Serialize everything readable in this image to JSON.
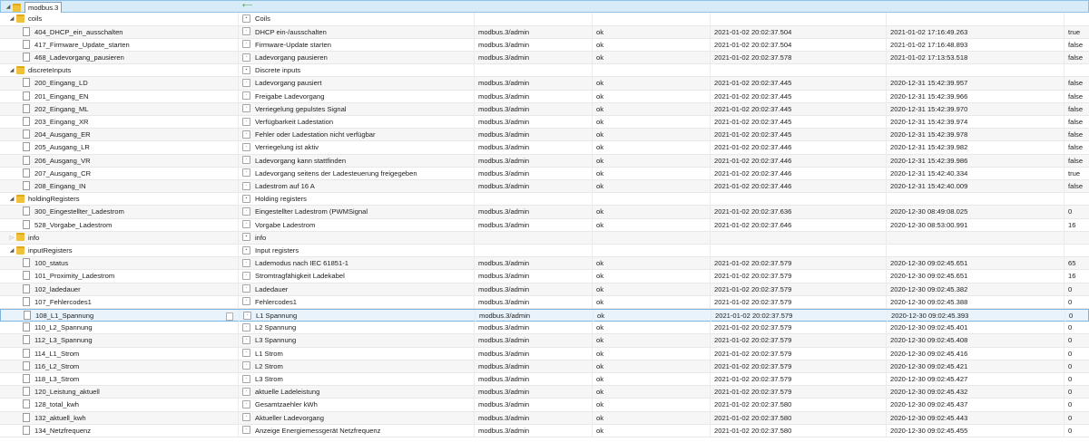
{
  "root": {
    "id": "modbus.3",
    "handle": "⟵"
  },
  "rows": [
    {
      "id": "coils",
      "kind": "folder",
      "level": 1,
      "expanded": true,
      "name": "Coils",
      "role": "",
      "val": "",
      "ts": "",
      "lc": "",
      "v": ""
    },
    {
      "id": "404_DHCP_ein_ausschalten",
      "kind": "state",
      "level": 2,
      "name": "DHCP ein-/ausschalten",
      "role": "modbus.3/admin",
      "val": "ok",
      "ts": "2021-01-02 20:02:37.504",
      "lc": "2021-01-02 17:16:49.263",
      "v": "true"
    },
    {
      "id": "417_Firmware_Update_starten",
      "kind": "state",
      "level": 2,
      "name": "Firmware-Update starten",
      "role": "modbus.3/admin",
      "val": "ok",
      "ts": "2021-01-02 20:02:37.504",
      "lc": "2021-01-02 17:16:48.893",
      "v": "false"
    },
    {
      "id": "468_Ladevorgang_pausieren",
      "kind": "state",
      "level": 2,
      "name": "Ladevorgang pausieren",
      "role": "modbus.3/admin",
      "val": "ok",
      "ts": "2021-01-02 20:02:37.578",
      "lc": "2021-01-02 17:13:53.518",
      "v": "false"
    },
    {
      "id": "discreteInputs",
      "kind": "folder",
      "level": 1,
      "expanded": true,
      "name": "Discrete inputs",
      "role": "",
      "val": "",
      "ts": "",
      "lc": "",
      "v": ""
    },
    {
      "id": "200_Eingang_LD",
      "kind": "state",
      "level": 2,
      "name": "Ladevorgang pausiert",
      "role": "modbus.3/admin",
      "val": "ok",
      "ts": "2021-01-02 20:02:37.445",
      "lc": "2020-12-31 15:42:39.957",
      "v": "false"
    },
    {
      "id": "201_Eingang_EN",
      "kind": "state",
      "level": 2,
      "name": "Freigabe Ladevorgang",
      "role": "modbus.3/admin",
      "val": "ok",
      "ts": "2021-01-02 20:02:37.445",
      "lc": "2020-12-31 15:42:39.966",
      "v": "false"
    },
    {
      "id": "202_Eingang_ML",
      "kind": "state",
      "level": 2,
      "name": "Verriegelung gepulstes Signal",
      "role": "modbus.3/admin",
      "val": "ok",
      "ts": "2021-01-02 20:02:37.445",
      "lc": "2020-12-31 15:42:39.970",
      "v": "false"
    },
    {
      "id": "203_Eingang_XR",
      "kind": "state",
      "level": 2,
      "name": "Verfügbarkeit Ladestation",
      "role": "modbus.3/admin",
      "val": "ok",
      "ts": "2021-01-02 20:02:37.445",
      "lc": "2020-12-31 15:42:39.974",
      "v": "false"
    },
    {
      "id": "204_Ausgang_ER",
      "kind": "state",
      "level": 2,
      "name": "Fehler oder Ladestation nicht verfügbar",
      "role": "modbus.3/admin",
      "val": "ok",
      "ts": "2021-01-02 20:02:37.445",
      "lc": "2020-12-31 15:42:39.978",
      "v": "false"
    },
    {
      "id": "205_Ausgang_LR",
      "kind": "state",
      "level": 2,
      "name": "Verriegelung ist aktiv",
      "role": "modbus.3/admin",
      "val": "ok",
      "ts": "2021-01-02 20:02:37.446",
      "lc": "2020-12-31 15:42:39.982",
      "v": "false"
    },
    {
      "id": "206_Ausgang_VR",
      "kind": "state",
      "level": 2,
      "name": "Ladevorgang kann stattfinden",
      "role": "modbus.3/admin",
      "val": "ok",
      "ts": "2021-01-02 20:02:37.446",
      "lc": "2020-12-31 15:42:39.986",
      "v": "false"
    },
    {
      "id": "207_Ausgang_CR",
      "kind": "state",
      "level": 2,
      "name": "Ladevorgang seitens der Ladesteuerung freigegeben",
      "role": "modbus.3/admin",
      "val": "ok",
      "ts": "2021-01-02 20:02:37.446",
      "lc": "2020-12-31 15:42:40.334",
      "v": "true"
    },
    {
      "id": "208_Eingang_IN",
      "kind": "state",
      "level": 2,
      "name": "Ladestrom auf 16 A",
      "role": "modbus.3/admin",
      "val": "ok",
      "ts": "2021-01-02 20:02:37.446",
      "lc": "2020-12-31 15:42:40.009",
      "v": "false"
    },
    {
      "id": "holdingRegisters",
      "kind": "folder",
      "level": 1,
      "expanded": true,
      "name": "Holding registers",
      "role": "",
      "val": "",
      "ts": "",
      "lc": "",
      "v": ""
    },
    {
      "id": "300_Eingestellter_Ladestrom",
      "kind": "state",
      "level": 2,
      "name": "Eingestellter Ladestrom (PWMSignal",
      "role": "modbus.3/admin",
      "val": "ok",
      "ts": "2021-01-02 20:02:37.636",
      "lc": "2020-12-30 08:49:08.025",
      "v": "0"
    },
    {
      "id": "528_Vorgabe_Ladestrom",
      "kind": "state",
      "level": 2,
      "name": "Vorgabe Ladestrom",
      "role": "modbus.3/admin",
      "val": "ok",
      "ts": "2021-01-02 20:02:37.646",
      "lc": "2020-12-30 08:53:00.991",
      "v": "16"
    },
    {
      "id": "info",
      "kind": "folder",
      "level": 1,
      "expanded": false,
      "name": "info",
      "role": "",
      "val": "",
      "ts": "",
      "lc": "",
      "v": ""
    },
    {
      "id": "inputRegisters",
      "kind": "folder",
      "level": 1,
      "expanded": true,
      "name": "Input registers",
      "role": "",
      "val": "",
      "ts": "",
      "lc": "",
      "v": ""
    },
    {
      "id": "100_status",
      "kind": "state",
      "level": 2,
      "name": "Lademodus nach IEC 61851-1",
      "role": "modbus.3/admin",
      "val": "ok",
      "ts": "2021-01-02 20:02:37.579",
      "lc": "2020-12-30 09:02:45.651",
      "v": "65"
    },
    {
      "id": "101_Proximity_Ladestrom",
      "kind": "state",
      "level": 2,
      "name": "Stromtragfähigkeit Ladekabel",
      "role": "modbus.3/admin",
      "val": "ok",
      "ts": "2021-01-02 20:02:37.579",
      "lc": "2020-12-30 09:02:45.651",
      "v": "16"
    },
    {
      "id": "102_ladedauer",
      "kind": "state",
      "level": 2,
      "name": "Ladedauer",
      "role": "modbus.3/admin",
      "val": "ok",
      "ts": "2021-01-02 20:02:37.579",
      "lc": "2020-12-30 09:02:45.382",
      "v": "0"
    },
    {
      "id": "107_Fehlercodes1",
      "kind": "state",
      "level": 2,
      "name": "Fehlercodes1",
      "role": "modbus.3/admin",
      "val": "ok",
      "ts": "2021-01-02 20:02:37.579",
      "lc": "2020-12-30 09:02:45.388",
      "v": "0"
    },
    {
      "id": "108_L1_Spannung",
      "kind": "state",
      "level": 2,
      "selected": true,
      "name": "L1 Spannung",
      "role": "modbus.3/admin",
      "val": "ok",
      "ts": "2021-01-02 20:02:37.579",
      "lc": "2020-12-30 09:02:45.393",
      "v": "0"
    },
    {
      "id": "110_L2_Spannung",
      "kind": "state",
      "level": 2,
      "name": "L2 Spannung",
      "role": "modbus.3/admin",
      "val": "ok",
      "ts": "2021-01-02 20:02:37.579",
      "lc": "2020-12-30 09:02:45.401",
      "v": "0"
    },
    {
      "id": "112_L3_Spannung",
      "kind": "state",
      "level": 2,
      "name": "L3 Spannung",
      "role": "modbus.3/admin",
      "val": "ok",
      "ts": "2021-01-02 20:02:37.579",
      "lc": "2020-12-30 09:02:45.408",
      "v": "0"
    },
    {
      "id": "114_L1_Strom",
      "kind": "state",
      "level": 2,
      "name": "L1 Strom",
      "role": "modbus.3/admin",
      "val": "ok",
      "ts": "2021-01-02 20:02:37.579",
      "lc": "2020-12-30 09:02:45.416",
      "v": "0"
    },
    {
      "id": "116_L2_Strom",
      "kind": "state",
      "level": 2,
      "name": "L2 Strom",
      "role": "modbus.3/admin",
      "val": "ok",
      "ts": "2021-01-02 20:02:37.579",
      "lc": "2020-12-30 09:02:45.421",
      "v": "0"
    },
    {
      "id": "118_L3_Strom",
      "kind": "state",
      "level": 2,
      "name": "L3 Strom",
      "role": "modbus.3/admin",
      "val": "ok",
      "ts": "2021-01-02 20:02:37.579",
      "lc": "2020-12-30 09:02:45.427",
      "v": "0"
    },
    {
      "id": "120_Leistung_aktuell",
      "kind": "state",
      "level": 2,
      "name": "aktuelle Ladeleistung",
      "role": "modbus.3/admin",
      "val": "ok",
      "ts": "2021-01-02 20:02:37.579",
      "lc": "2020-12-30 09:02:45.432",
      "v": "0"
    },
    {
      "id": "128_total_kwh",
      "kind": "state",
      "level": 2,
      "name": "Gesamtzaehler kWh",
      "role": "modbus.3/admin",
      "val": "ok",
      "ts": "2021-01-02 20:02:37.580",
      "lc": "2020-12-30 09:02:45.437",
      "v": "0"
    },
    {
      "id": "132_aktuell_kwh",
      "kind": "state",
      "level": 2,
      "name": "Aktueller Ladevorgang",
      "role": "modbus.3/admin",
      "val": "ok",
      "ts": "2021-01-02 20:02:37.580",
      "lc": "2020-12-30 09:02:45.443",
      "v": "0"
    },
    {
      "id": "134_Netzfrequenz",
      "kind": "state",
      "level": 2,
      "name": "Anzeige Energiemessgerät Netzfrequenz",
      "role": "modbus.3/admin",
      "val": "ok",
      "ts": "2021-01-02 20:02:37.580",
      "lc": "2020-12-30 09:02:45.455",
      "v": "0"
    }
  ],
  "colors": {
    "folder": "#f0c23c",
    "selection": "#e9f3fb",
    "header": "#d8ebf8"
  }
}
